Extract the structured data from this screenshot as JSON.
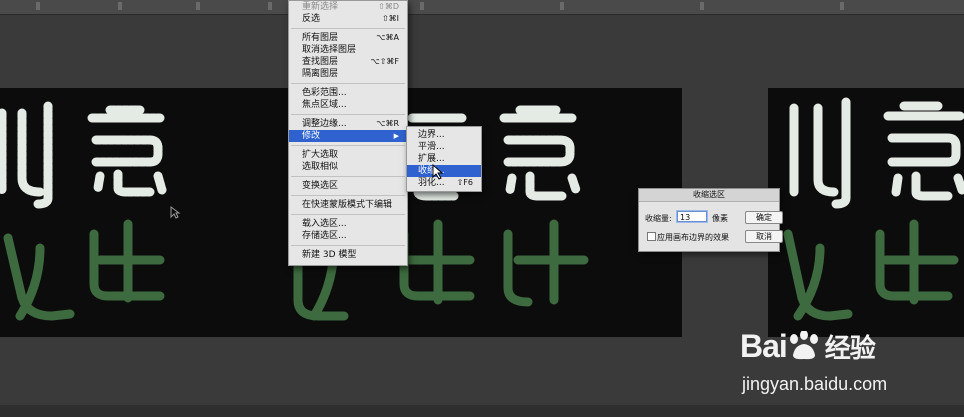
{
  "colors": {
    "menu_bg": "#e6e6e6",
    "highlight": "#2f62cf",
    "text_white": "#e6ece6",
    "text_green": "#3c6a3e",
    "canvas": "#0c0c0c"
  },
  "main_menu": {
    "items": [
      {
        "label": "重新选择",
        "shortcut": "⇧⌘D",
        "dim": true
      },
      {
        "label": "反选",
        "shortcut": "⇧⌘I"
      },
      {
        "label": "所有图层",
        "shortcut": "⌥⌘A"
      },
      {
        "label": "取消选择图层",
        "shortcut": ""
      },
      {
        "label": "查找图层",
        "shortcut": "⌥⇧⌘F"
      },
      {
        "label": "隔离图层",
        "shortcut": ""
      },
      {
        "label": "色彩范围...",
        "shortcut": ""
      },
      {
        "label": "焦点区域...",
        "shortcut": ""
      },
      {
        "label": "调整边缘...",
        "shortcut": "⌥⌘R"
      },
      {
        "label": "修改",
        "shortcut": ""
      },
      {
        "label": "扩大选取",
        "shortcut": ""
      },
      {
        "label": "选取相似",
        "shortcut": ""
      },
      {
        "label": "变换选区",
        "shortcut": ""
      },
      {
        "label": "在快速蒙版模式下编辑",
        "shortcut": ""
      },
      {
        "label": "载入选区...",
        "shortcut": ""
      },
      {
        "label": "存储选区...",
        "shortcut": ""
      },
      {
        "label": "新建 3D 模型",
        "shortcut": ""
      }
    ]
  },
  "submenu": {
    "items": [
      {
        "label": "边界...",
        "shortcut": ""
      },
      {
        "label": "平滑...",
        "shortcut": ""
      },
      {
        "label": "扩展...",
        "shortcut": ""
      },
      {
        "label": "收缩...",
        "shortcut": ""
      },
      {
        "label": "羽化...",
        "shortcut": "⇧F6"
      }
    ]
  },
  "dialog": {
    "title": "收缩选区",
    "amount_label": "收缩量:",
    "amount_value": "13",
    "unit": "像素",
    "ok": "确定",
    "cancel": "取消",
    "checkbox_label": "应用画布边界的效果"
  },
  "canvas_text": {
    "line1": "创意",
    "line2": "设计"
  },
  "watermark": {
    "brand_prefix": "Bai",
    "brand_suffix": "经验",
    "url": "jingyan.baidu.com"
  }
}
